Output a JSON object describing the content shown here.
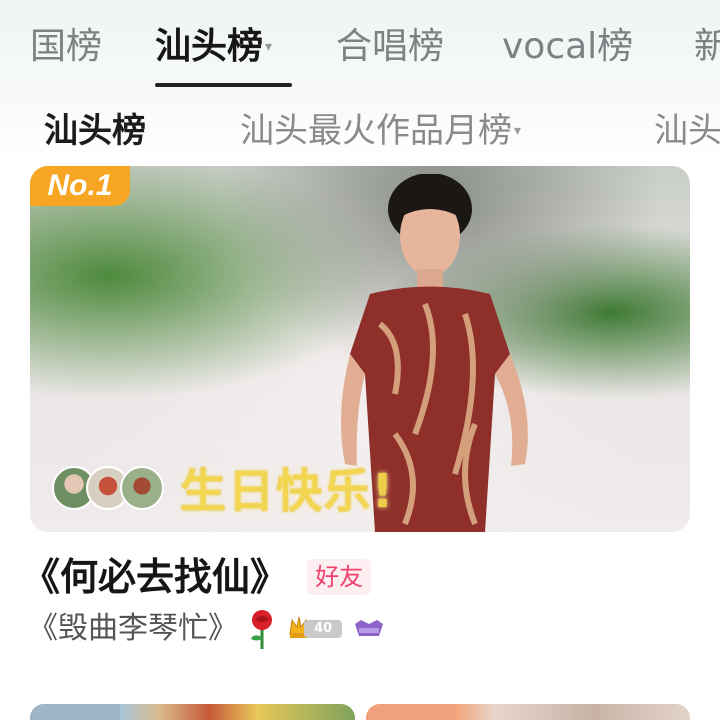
{
  "tabs": {
    "primary": [
      {
        "label": "国榜",
        "active": false
      },
      {
        "label": "汕头榜",
        "active": true,
        "has_dropdown": true
      },
      {
        "label": "合唱榜",
        "active": false
      },
      {
        "label": "vocal榜",
        "active": false
      },
      {
        "label": "新",
        "active": false
      }
    ],
    "secondary": [
      {
        "label": "汕头榜",
        "active": true
      },
      {
        "label": "汕头最火作品月榜",
        "active": false,
        "has_dropdown": true
      },
      {
        "label": "汕头",
        "active": false
      }
    ]
  },
  "top_card": {
    "rank_badge": "No.1",
    "cover_caption": "生日快乐!",
    "song_title": "《何必去找仙》",
    "friend_tag": "好友",
    "singer": "《毁曲李琴忙》",
    "level": "40"
  },
  "colors": {
    "accent_gold": "#f6a623",
    "friend_pink": "#f0426c",
    "active_tab": "#161616",
    "inactive_tab": "#7d8184"
  },
  "icons": [
    "rose-icon",
    "crown-icon",
    "vip-icon"
  ]
}
